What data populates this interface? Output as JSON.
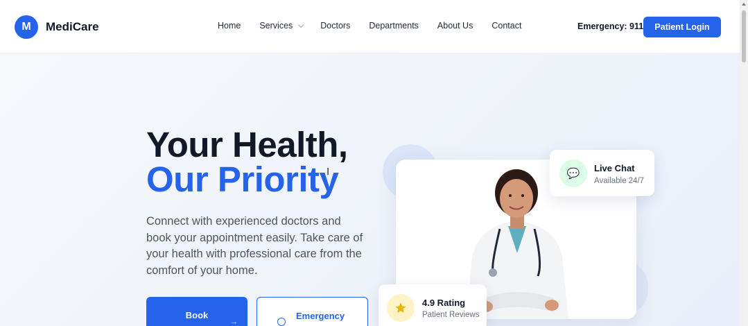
{
  "brand": {
    "logo_letter": "M",
    "name": "MediCare",
    "accent": "#2563eb"
  },
  "nav": {
    "links": [
      "Home",
      "Services",
      "Doctors",
      "Departments",
      "About Us",
      "Contact"
    ],
    "emergency_text": "Emergency: 911",
    "login_label": "Patient Login"
  },
  "hero": {
    "headline_line1": "Your Health,",
    "headline_line2": "Our Priority",
    "description": "Connect with experienced doctors and book your appointment easily. Take care of your health with professional care from the comfort of your home.",
    "primary_button": "Book",
    "secondary_button": "Emergency"
  },
  "chat_card": {
    "icon": "chat-bubble-icon",
    "title": "Live Chat",
    "subtitle": "Available 24/7"
  },
  "rating_card": {
    "icon": "star-icon",
    "title": "4.9 Rating",
    "subtitle": "Patient Reviews"
  }
}
